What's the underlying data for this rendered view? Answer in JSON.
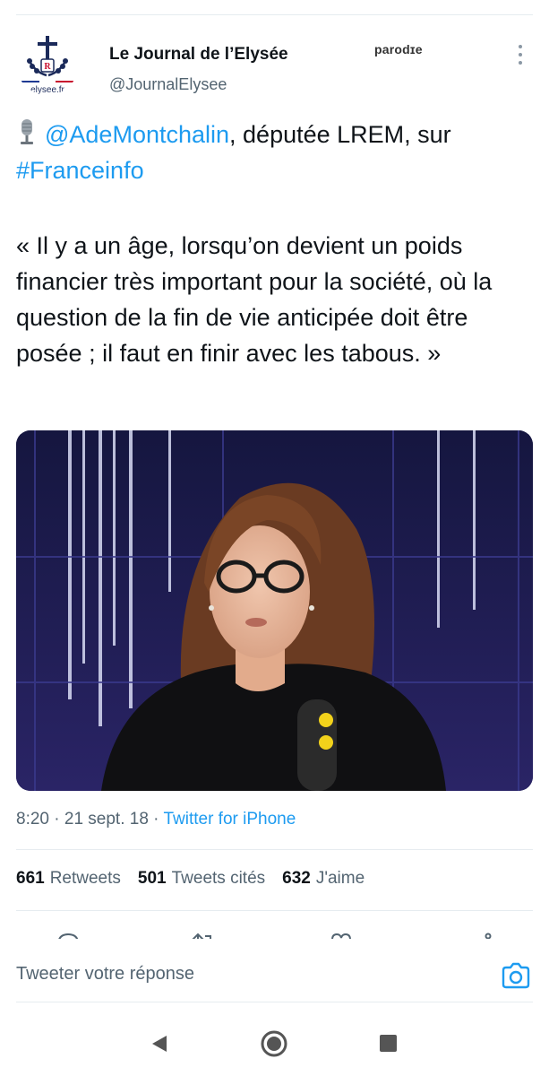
{
  "tweet": {
    "author": {
      "display_name": "Le Journal de l’Elysée",
      "handle": "@JournalElysee",
      "badge": "parodɪe",
      "avatar_caption": "elysee.fr",
      "avatar_monogram": "R"
    },
    "mention": "@AdeMontchalin",
    "text_after_mention": ", députée LREM, sur",
    "hashtag": "#Franceinfo",
    "quote": "« Il y a un âge, lorsqu’on devient un poids financier très important pour la société, où la question de la fin de vie anticipée doit être posée ; il faut en finir avec les tabous. »",
    "meta": {
      "time": "8:20",
      "separator": " · ",
      "date": "21 sept. 18",
      "separator2": " · ",
      "source": "Twitter for iPhone"
    },
    "stats": [
      {
        "count": "661",
        "label": "Retweets"
      },
      {
        "count": "501",
        "label": "Tweets cités"
      },
      {
        "count": "632",
        "label": "J'aime"
      }
    ]
  },
  "reply": {
    "placeholder": "Tweeter votre réponse"
  },
  "icons": {
    "mic": "studio-microphone-icon",
    "more": "more-vertical-icon",
    "camera": "camera-icon",
    "back": "back-triangle-icon",
    "home": "home-circle-icon",
    "recent": "recent-apps-square-icon"
  },
  "colors": {
    "link": "#1d9bf0",
    "secondary_text": "#536471",
    "primary_text": "#0f1419",
    "flag_blue": "#1f3a93",
    "flag_red": "#c8102e"
  }
}
